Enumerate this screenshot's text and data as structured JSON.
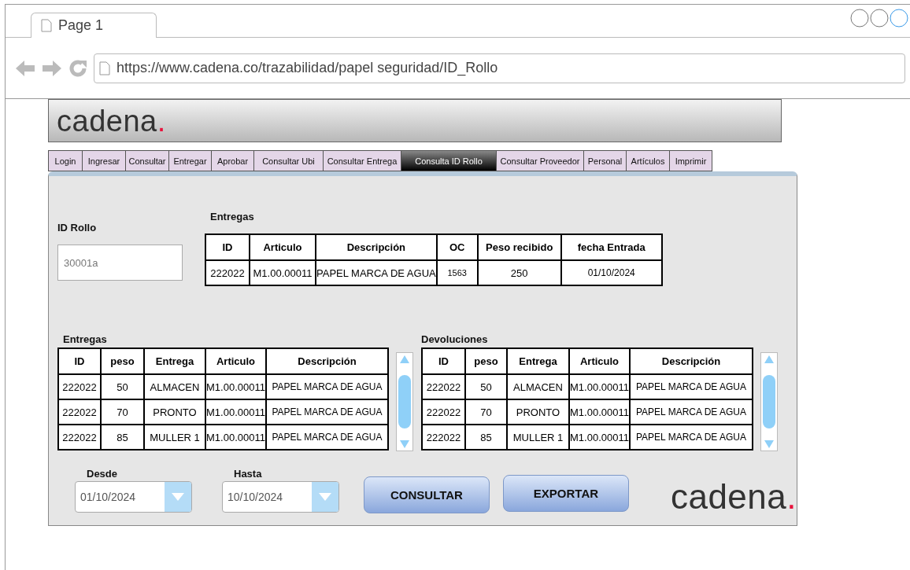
{
  "browser": {
    "tab_title": "Page 1",
    "url": "https://www.cadena.co/trazabilidad/papel seguridad/ID_Rollo"
  },
  "header": {
    "logo_word": "cadena",
    "logo_dot": "."
  },
  "nav": [
    {
      "label": "Login",
      "selected": false
    },
    {
      "label": "Ingresar",
      "selected": false
    },
    {
      "label": "Consultar",
      "selected": false
    },
    {
      "label": "Entregar",
      "selected": false
    },
    {
      "label": "Aprobar",
      "selected": false
    },
    {
      "label": "Consultar Ubi",
      "selected": false
    },
    {
      "label": "Consultar Entrega",
      "selected": false
    },
    {
      "label": "Consulta ID Rollo",
      "selected": true
    },
    {
      "label": "Consultar Proveedor",
      "selected": false
    },
    {
      "label": "Personal",
      "selected": false
    },
    {
      "label": "Artículos",
      "selected": false
    },
    {
      "label": "Imprimir",
      "selected": false
    }
  ],
  "id_rollo": {
    "label": "ID Rollo",
    "value": "30001a"
  },
  "summary": {
    "title": "Entregas",
    "columns": [
      "ID",
      "Articulo",
      "Descripción",
      "OC",
      "Peso recibido",
      "fecha Entrada"
    ],
    "rows": [
      [
        "222022",
        "M1.00.00011",
        "PAPEL MARCA DE AGUA",
        "1563",
        "250",
        "01/10/2024"
      ]
    ]
  },
  "entregas": {
    "title": "Entregas",
    "columns": [
      "ID",
      "peso",
      "Entrega",
      "Articulo",
      "Descripción"
    ],
    "rows": [
      [
        "222022",
        "50",
        "ALMACEN",
        "M1.00.00011",
        "PAPEL MARCA DE AGUA"
      ],
      [
        "222022",
        "70",
        "PRONTO",
        "M1.00.00011",
        "PAPEL MARCA DE AGUA"
      ],
      [
        "222022",
        "85",
        "MULLER 1",
        "M1.00.00011",
        "PAPEL MARCA DE AGUA"
      ]
    ]
  },
  "devoluciones": {
    "title": "Devoluciones",
    "columns": [
      "ID",
      "peso",
      "Entrega",
      "Articulo",
      "Descripción"
    ],
    "rows": [
      [
        "222022",
        "50",
        "ALMACEN",
        "M1.00.00011",
        "PAPEL MARCA DE AGUA"
      ],
      [
        "222022",
        "70",
        "PRONTO",
        "M1.00.00011",
        "PAPEL MARCA DE AGUA"
      ],
      [
        "222022",
        "85",
        "MULLER 1",
        "M1.00.00011",
        "PAPEL MARCA DE AGUA"
      ]
    ]
  },
  "filters": [
    {
      "label": "Desde",
      "value": "01/10/2024"
    },
    {
      "label": "Hasta",
      "value": "10/10/2024"
    }
  ],
  "buttons": [
    "CONSULTAR",
    "EXPORTAR"
  ],
  "footer_logo": {
    "logo_word": "cadena",
    "logo_dot": "."
  }
}
